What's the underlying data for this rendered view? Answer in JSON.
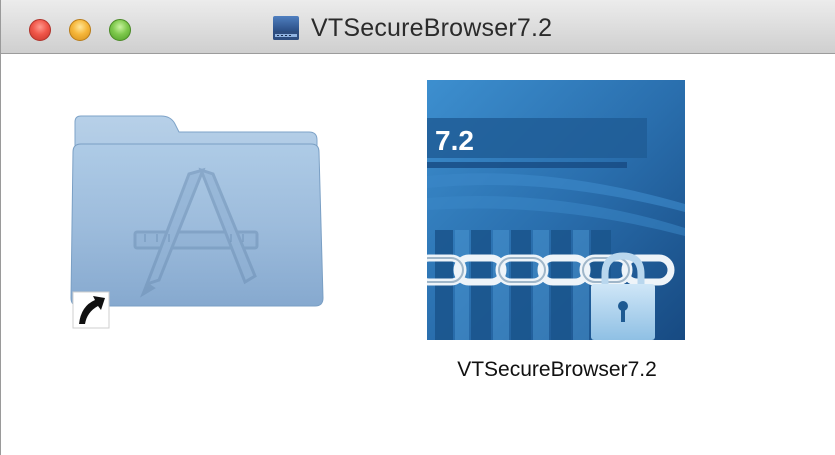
{
  "window": {
    "title": "VTSecureBrowser7.2",
    "title_icon": "disk-image-icon"
  },
  "items": [
    {
      "name": "applications-folder-alias",
      "icon": "applications-folder-icon",
      "badge": "alias-arrow-icon",
      "label": ""
    },
    {
      "name": "vtsecurebrowser-app",
      "icon": "secure-browser-app-icon",
      "icon_text": "7.2",
      "label": "VTSecureBrowser7.2"
    }
  ],
  "colors": {
    "close": "#f0574a",
    "minimize": "#f6b73b",
    "zoom": "#7fc94d",
    "folder": "#9dbcd9",
    "app_bg": "#1d5f9a"
  }
}
